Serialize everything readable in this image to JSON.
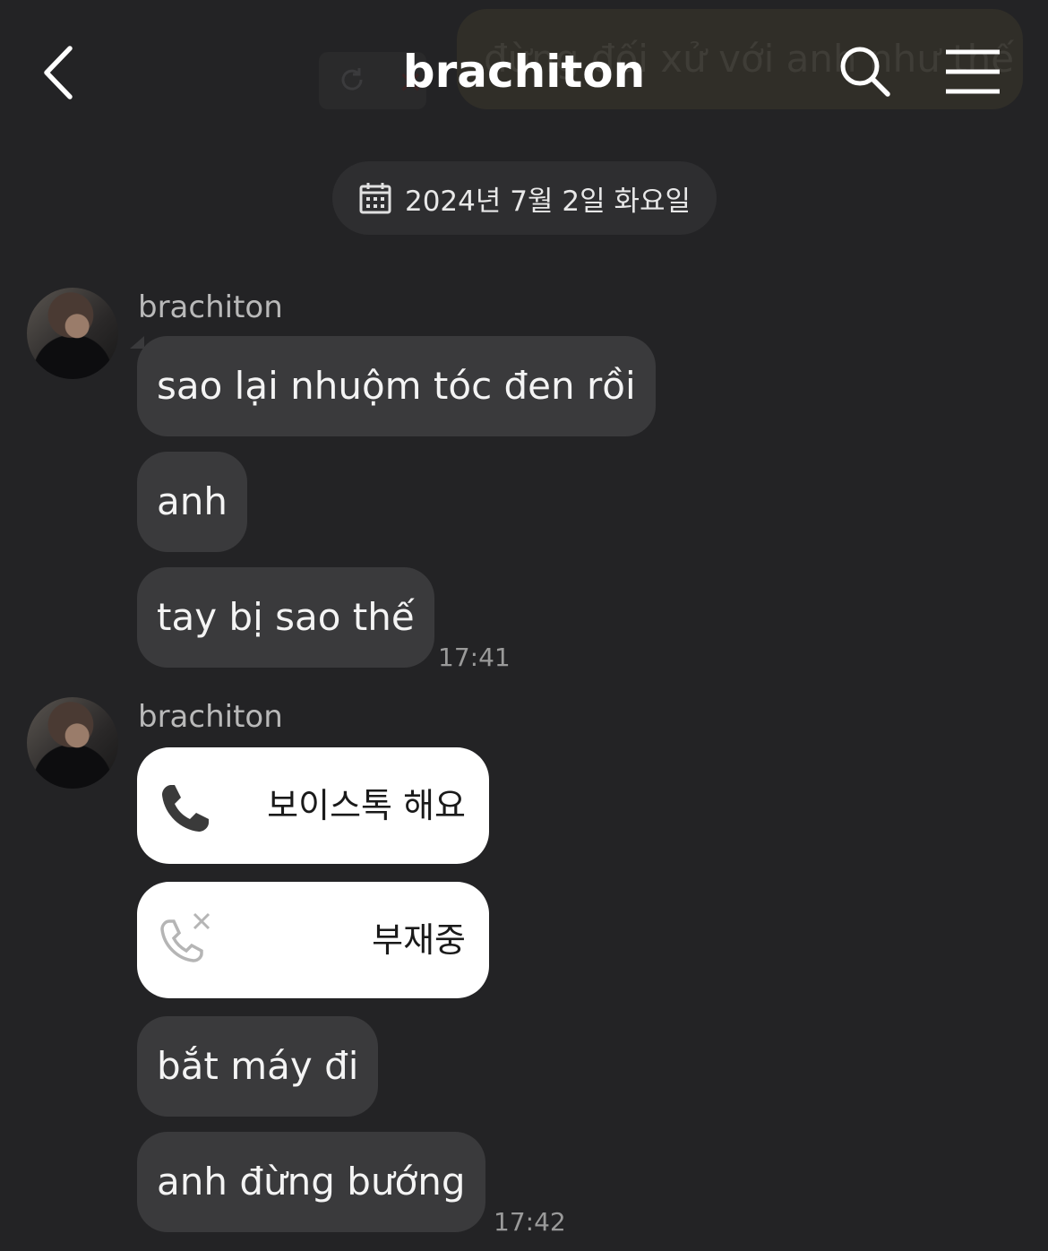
{
  "header": {
    "title": "brachiton",
    "ghost_message": "đừng đối xử với anh như thế"
  },
  "date_divider": "2024년 7월 2일 화요일",
  "groups": [
    {
      "sender": "brachiton",
      "messages": [
        "sao lại nhuộm tóc đen rồi",
        "anh",
        "tay bị sao thế"
      ],
      "time": "17:41"
    },
    {
      "sender": "brachiton",
      "calls": [
        {
          "label": "보이스톡 해요",
          "icon": "phone-icon"
        },
        {
          "label": "부재중",
          "icon": "missed-call-icon"
        }
      ],
      "messages": [
        "bắt máy đi",
        "anh đừng bướng"
      ],
      "time": "17:42"
    }
  ],
  "colors": {
    "background": "#232325",
    "bubble": "#3a3a3c",
    "call_card": "#ffffff"
  }
}
